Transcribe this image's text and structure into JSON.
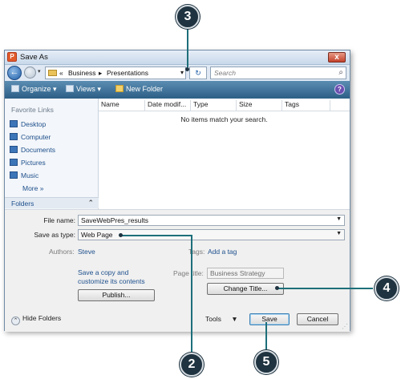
{
  "window": {
    "title": "Save As",
    "close_label": "x"
  },
  "nav": {
    "back_glyph": "←",
    "dropdown_glyph": "▾"
  },
  "address": {
    "prefix": "«",
    "crumbs": [
      "Business",
      "Presentations"
    ],
    "separator": "▸",
    "dropdown_glyph": "▾"
  },
  "refresh_glyph": "↻",
  "search": {
    "placeholder": "Search",
    "icon": "search-icon"
  },
  "toolbar": {
    "organize": "Organize",
    "views": "Views",
    "new_folder": "New Folder",
    "dropdown_glyph": "▾",
    "help": "?"
  },
  "left_pane": {
    "title": "Favorite Links",
    "items": [
      {
        "label": "Desktop",
        "icon": "desktop-icon"
      },
      {
        "label": "Computer",
        "icon": "computer-icon"
      },
      {
        "label": "Documents",
        "icon": "documents-icon"
      },
      {
        "label": "Pictures",
        "icon": "pictures-icon"
      },
      {
        "label": "Music",
        "icon": "music-icon"
      }
    ],
    "more": "More",
    "more_glyph": "»",
    "folders": "Folders",
    "folders_chevron": "⌃"
  },
  "file_list": {
    "columns": [
      "Name",
      "Date modif...",
      "Type",
      "Size",
      "Tags"
    ],
    "empty_message": "No items match your search."
  },
  "form": {
    "file_name_label": "File name:",
    "file_name_value": "SaveWebPres_results",
    "save_type_label": "Save as type:",
    "save_type_value": "Web Page",
    "authors_label": "Authors:",
    "authors_value": "Steve",
    "tags_label": "Tags:",
    "tags_value": "Add a tag",
    "save_copy_line1": "Save a copy and",
    "save_copy_line2": "customize its contents",
    "page_title_label": "Page title:",
    "page_title_value": "Business Strategy",
    "publish_button": "Publish...",
    "change_title_button": "Change Title...",
    "hide_folders": "Hide Folders",
    "hide_folders_glyph": "⌃",
    "tools": "Tools",
    "save_button": "Save",
    "cancel_button": "Cancel"
  },
  "callouts": [
    "3",
    "2",
    "4",
    "5"
  ],
  "colors": {
    "toolbar": "#2d5f86",
    "callout": "#1f3340",
    "callout_line": "#1d6f7a"
  }
}
